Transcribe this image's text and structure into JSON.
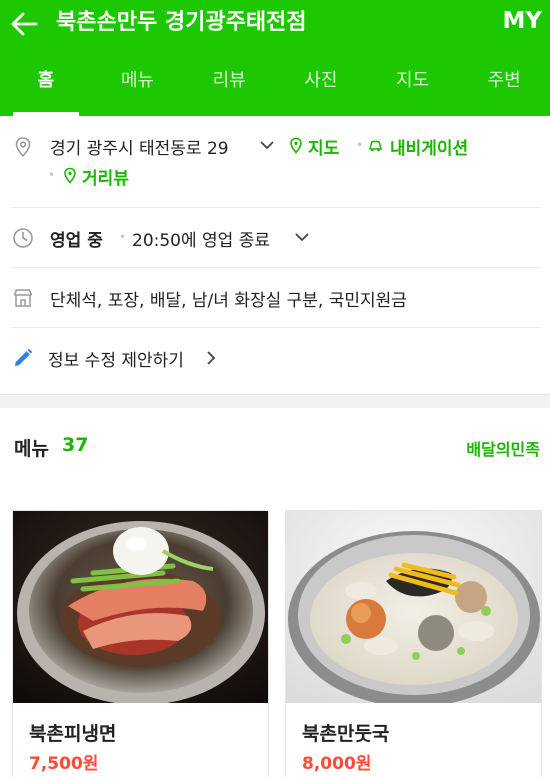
{
  "header": {
    "title": "북촌손만두 경기광주태전점",
    "my_label": "MY"
  },
  "tabs": [
    {
      "label": "홈",
      "active": true
    },
    {
      "label": "메뉴"
    },
    {
      "label": "리뷰"
    },
    {
      "label": "사진"
    },
    {
      "label": "지도"
    },
    {
      "label": "주변"
    }
  ],
  "info": {
    "address": "경기 광주시 태전동로 29",
    "map_link": "지도",
    "navigation_link": "내비게이션",
    "street_view_link": "거리뷰",
    "status": "영업 중",
    "hours_text": "20:50에 영업 종료",
    "amenities": "단체석, 포장, 배달, 남/녀 화장실 구분, 국민지원금",
    "edit_suggestion": "정보 수정 제안하기"
  },
  "menu": {
    "title": "메뉴",
    "count": "37",
    "delivery_link": "배달의민족",
    "items": [
      {
        "name": "북촌피냉면",
        "price": "7,500원"
      },
      {
        "name": "북촌만둣국",
        "price": "8,000원"
      }
    ]
  },
  "colors": {
    "brand_green": "#1ec800",
    "link_green": "#1bb600",
    "price_red": "#ff4a37"
  },
  "icons": [
    "back-arrow-icon",
    "map-pin-icon",
    "chevron-down-icon",
    "navigation-icon",
    "clock-icon",
    "store-icon",
    "pencil-icon",
    "chevron-right-icon"
  ]
}
